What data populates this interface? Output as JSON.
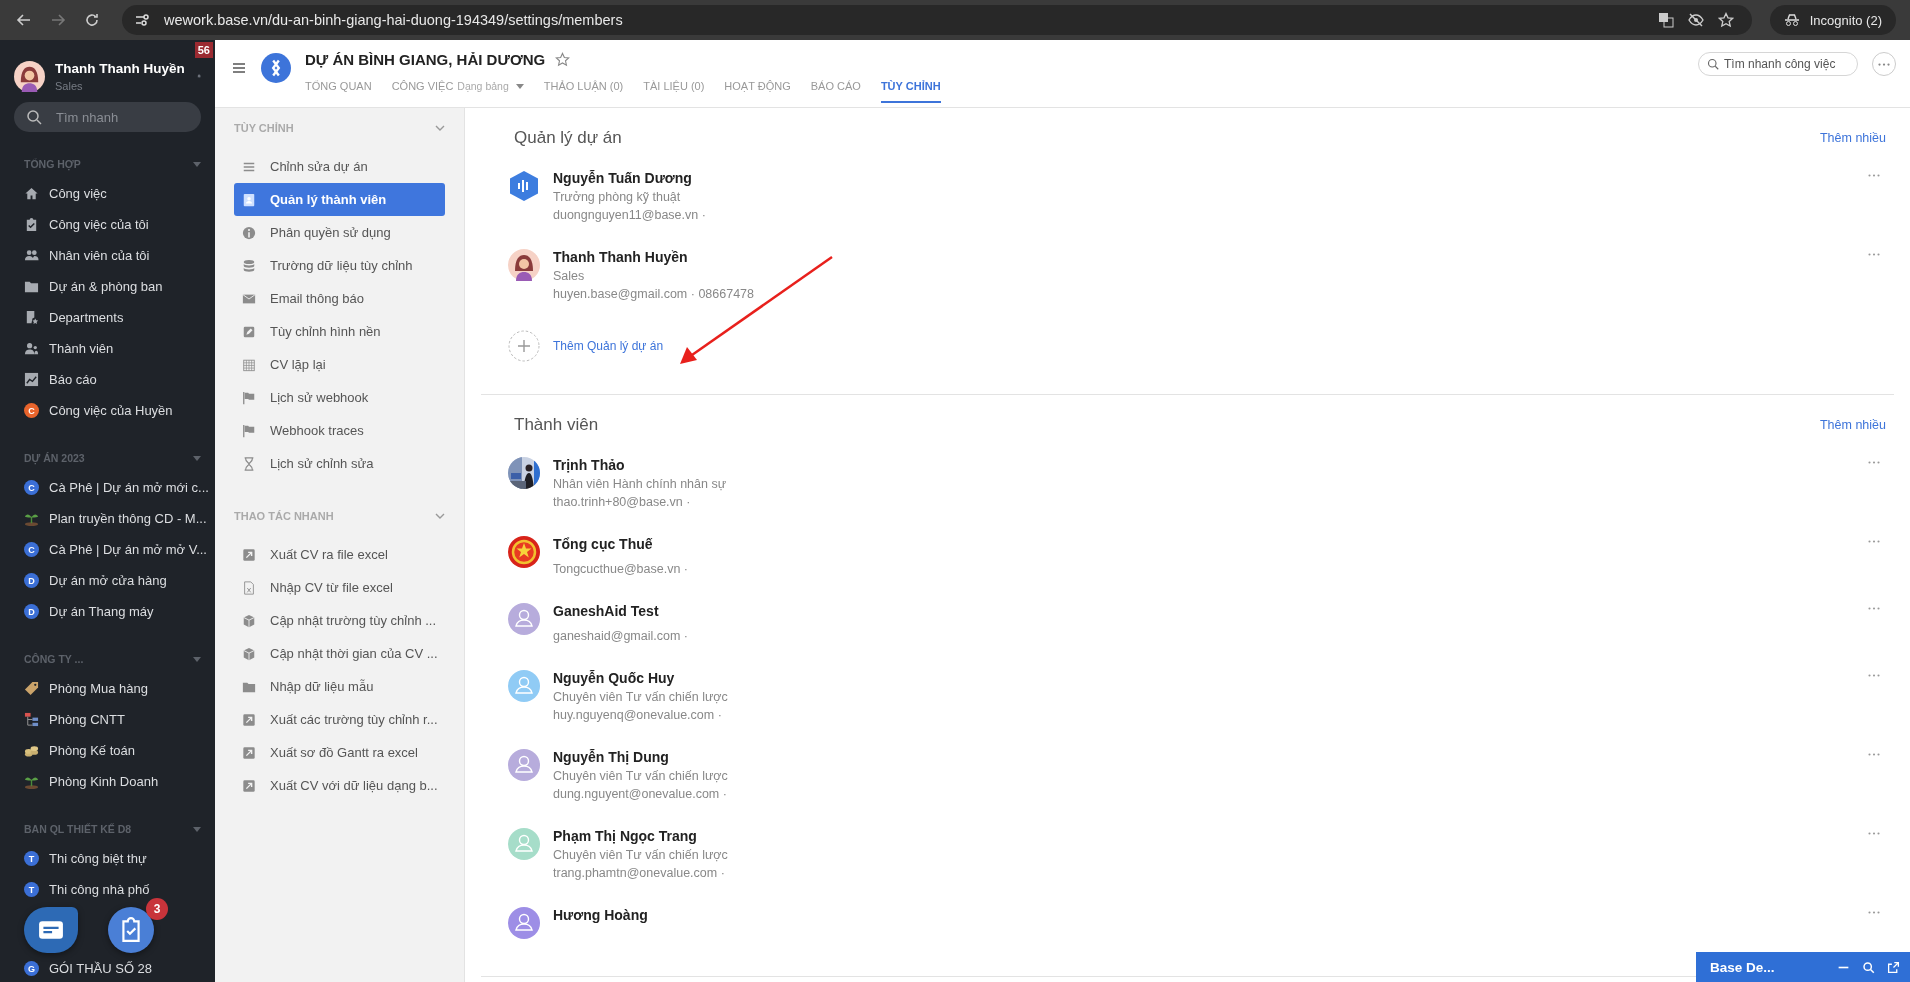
{
  "browser": {
    "url": "wework.base.vn/du-an-binh-giang-hai-duong-194349/settings/members",
    "profile": "Incognito (2)"
  },
  "sidebar": {
    "user": {
      "name": "Thanh Thanh Huyền",
      "role": "Sales",
      "notifications": "56"
    },
    "search": {
      "placeholder": "Tìm nhanh"
    },
    "sections": [
      {
        "title": "TỔNG HỢP",
        "items": [
          {
            "kind": "icon",
            "label": "Công việc"
          },
          {
            "kind": "icon",
            "label": "Công việc của tôi"
          },
          {
            "kind": "icon",
            "label": "Nhân viên của tôi"
          },
          {
            "kind": "icon",
            "label": "Dự án & phòng ban"
          },
          {
            "kind": "icon",
            "label": "Departments"
          },
          {
            "kind": "icon",
            "label": "Thành viên"
          },
          {
            "kind": "icon",
            "label": "Báo cáo"
          },
          {
            "kind": "letter",
            "letter": "C",
            "color": "#e8642c",
            "label": "Công việc của Huyền"
          }
        ]
      },
      {
        "title": "DỰ ÁN 2023",
        "items": [
          {
            "kind": "letter",
            "letter": "C",
            "color": "#3b6fd6",
            "label": "Cà Phê | Dự án mở mới c..."
          },
          {
            "kind": "icon",
            "label": "Plan truyền thông CD - M..."
          },
          {
            "kind": "letter",
            "letter": "C",
            "color": "#3b6fd6",
            "label": "Cà Phê | Dự án mở mở V..."
          },
          {
            "kind": "letter",
            "letter": "D",
            "color": "#3b6fd6",
            "label": "Dự án mở cửa hàng"
          },
          {
            "kind": "letter",
            "letter": "D",
            "color": "#3b6fd6",
            "label": "Dự án Thang máy"
          }
        ]
      },
      {
        "title": "CÔNG TY ...",
        "items": [
          {
            "kind": "icon",
            "label": "Phòng Mua hàng"
          },
          {
            "kind": "icon",
            "label": "Phòng CNTT"
          },
          {
            "kind": "icon",
            "label": "Phòng Kế toán"
          },
          {
            "kind": "icon",
            "label": "Phòng Kinh Doanh"
          }
        ]
      },
      {
        "title": "BAN QL THIẾT KẾ D8",
        "items": [
          {
            "kind": "letter",
            "letter": "T",
            "color": "#3b6fd6",
            "label": "Thi công biệt thự"
          },
          {
            "kind": "letter",
            "letter": "T",
            "color": "#3b6fd6",
            "label": "Thi công nhà phố"
          }
        ]
      },
      {
        "items": [
          {
            "kind": "letter",
            "letter": "G",
            "color": "#3b6fd6",
            "label": "GÓI THẦU SỐ 28"
          }
        ]
      }
    ]
  },
  "fabs": {
    "task_count": "3"
  },
  "project": {
    "title": "DỰ ÁN BÌNH GIANG, HẢI DƯƠNG",
    "search": {
      "placeholder": "Tìm nhanh công việc"
    },
    "tabs": [
      {
        "label": "TỔNG QUAN",
        "selected": false
      },
      {
        "label": "CÔNG VIỆC",
        "view": "Dạng bảng",
        "selected": false
      },
      {
        "label": "THẢO LUẬN (0)",
        "selected": false
      },
      {
        "label": "TÀI LIỆU (0)",
        "selected": false
      },
      {
        "label": "HOẠT ĐỘNG",
        "selected": false
      },
      {
        "label": "BÁO CÁO",
        "selected": false
      },
      {
        "label": "TÙY CHỈNH",
        "selected": true
      }
    ]
  },
  "settings_menu": {
    "sections": [
      {
        "title": "TÙY CHỈNH",
        "items": [
          {
            "label": "Chỉnh sửa dự án",
            "selected": false
          },
          {
            "label": "Quản lý thành viên",
            "selected": true
          },
          {
            "label": "Phân quyền sử dụng",
            "selected": false
          },
          {
            "label": "Trường dữ liệu tùy chỉnh",
            "selected": false
          },
          {
            "label": "Email thông báo",
            "selected": false
          },
          {
            "label": "Tùy chỉnh hình nền",
            "selected": false
          },
          {
            "label": "CV lặp lại",
            "selected": false
          },
          {
            "label": "Lịch sử webhook",
            "selected": false
          },
          {
            "label": "Webhook traces",
            "selected": false
          },
          {
            "label": "Lịch sử chỉnh sửa",
            "selected": false
          }
        ]
      },
      {
        "title": "THAO TÁC NHANH",
        "items": [
          {
            "label": "Xuất CV ra file excel",
            "selected": false
          },
          {
            "label": "Nhập CV từ file excel",
            "selected": false
          },
          {
            "label": "Cập nhật trường tùy chỉnh ...",
            "selected": false
          },
          {
            "label": "Cập nhật thời gian của CV ...",
            "selected": false
          },
          {
            "label": "Nhập dữ liệu mẫu",
            "selected": false
          },
          {
            "label": "Xuất các trường tùy chỉnh r...",
            "selected": false
          },
          {
            "label": "Xuất sơ đồ Gantt ra excel",
            "selected": false
          },
          {
            "label": "Xuất CV với dữ liệu dạng b...",
            "selected": false
          }
        ]
      }
    ]
  },
  "main": {
    "sections": [
      {
        "title": "Quản lý dự án",
        "more": "Thêm nhiều",
        "add": "Thêm Quản lý dự án",
        "members": [
          {
            "name": "Nguyễn Tuấn Dương",
            "position": "Trưởng phòng kỹ thuật",
            "contact": "duongnguyen11@base.vn ·",
            "avatar": {
              "kind": "hexagon"
            }
          },
          {
            "name": "Thanh Thanh Huyền",
            "position": "Sales",
            "contact": "huyen.base@gmail.com · 08667478",
            "avatar": {
              "kind": "illustration"
            }
          }
        ]
      },
      {
        "title": "Thành viên",
        "more": "Thêm nhiều",
        "members": [
          {
            "name": "Trịnh Thảo",
            "position": "Nhân viên Hành chính nhân sự",
            "contact": "thao.trinh+80@base.vn ·"
          },
          {
            "name": "Tổng cục Thuế",
            "contact": "Tongcucthue@base.vn ·",
            "avatar": {
              "kind": "emblem"
            }
          },
          {
            "name": "GaneshAid Test",
            "contact": "ganeshaid@gmail.com ·",
            "avatar": {
              "kind": "placeholder",
              "color": "#b7acdc"
            }
          },
          {
            "name": "Nguyễn Quốc Huy",
            "position": "Chuyên viên Tư vấn chiến lược",
            "contact": "huy.nguyenq@onevalue.com ·",
            "avatar": {
              "kind": "placeholder",
              "color": "#90cbf5"
            }
          },
          {
            "name": "Nguyễn Thị Dung",
            "position": "Chuyên viên Tư vấn chiến lược",
            "contact": "dung.nguyent@onevalue.com ·",
            "avatar": {
              "kind": "placeholder",
              "color": "#b7acdc"
            }
          },
          {
            "name": "Phạm Thị Ngọc Trang",
            "position": "Chuyên viên Tư vấn chiến lược",
            "contact": "trang.phamtn@onevalue.com ·",
            "avatar": {
              "kind": "placeholder",
              "color": "#a6ddc9"
            }
          },
          {
            "name": "Hương Hoàng",
            "avatar": {
              "kind": "placeholder",
              "color": "#9d8ee6"
            }
          }
        ]
      }
    ]
  },
  "dock": {
    "title": "Base De..."
  }
}
